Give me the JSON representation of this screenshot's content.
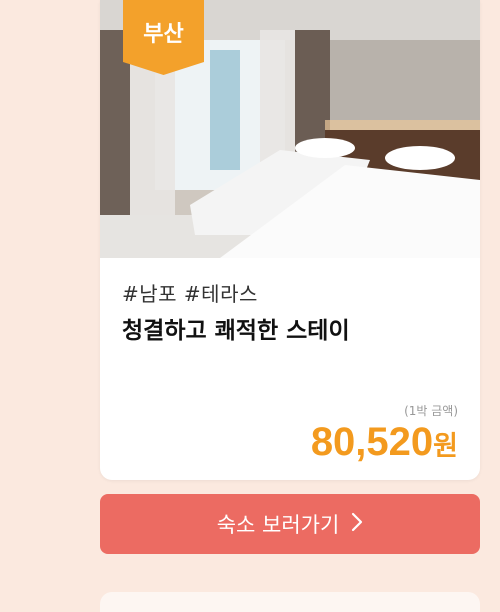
{
  "card": {
    "region_badge": "부산",
    "tags": "#남포  #테라스",
    "title": "청결하고 쾌적한 스테이",
    "price_note": "(1박 금액)",
    "price_amount": "80,520",
    "price_unit": "원"
  },
  "cta": {
    "label": "숙소 보러가기"
  },
  "colors": {
    "background": "#fbe9df",
    "badge": "#f3a12b",
    "price": "#f39a1e",
    "cta": "#ec6b62"
  }
}
